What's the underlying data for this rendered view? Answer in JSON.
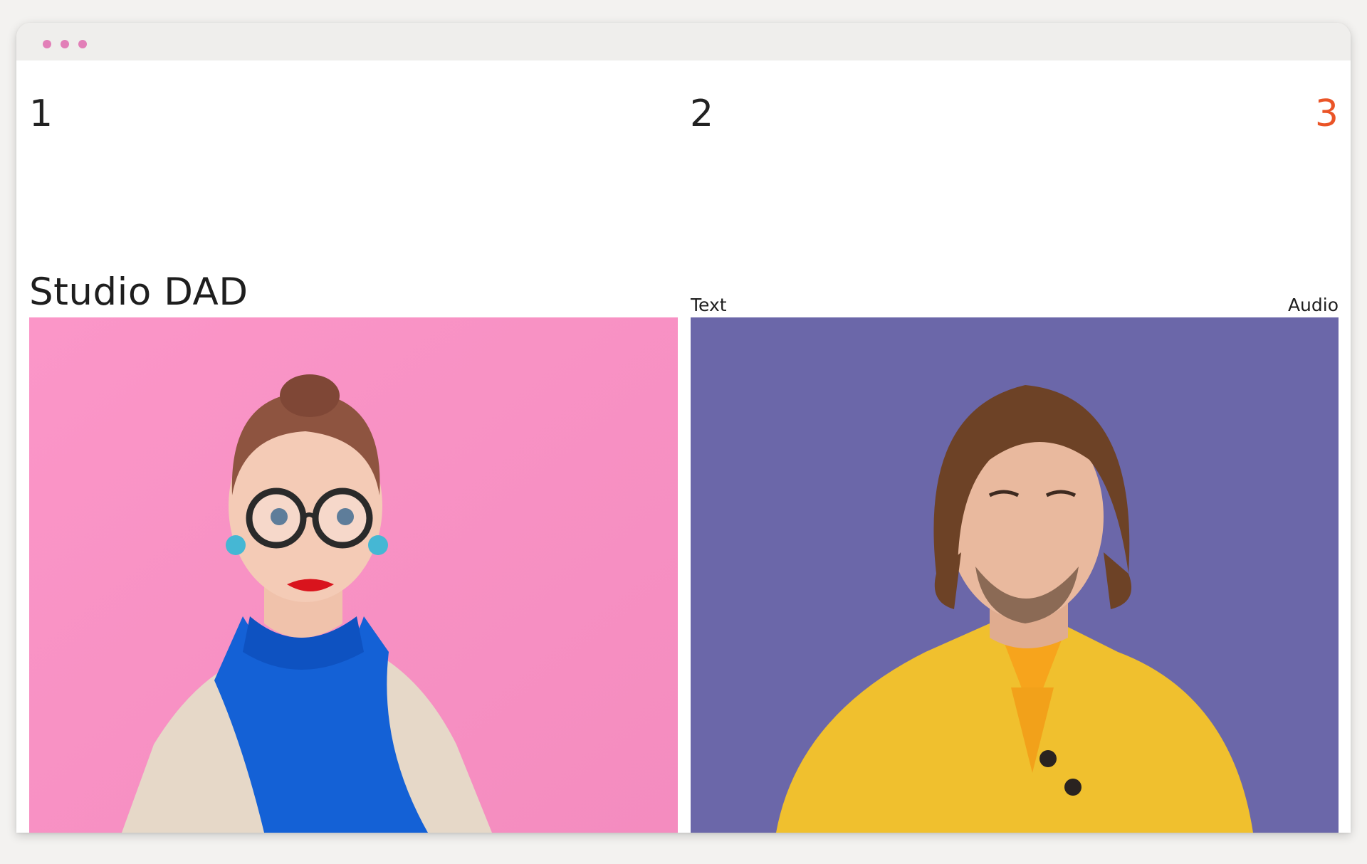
{
  "window": {
    "controls": [
      "window-dot",
      "window-dot",
      "window-dot"
    ],
    "dot_color": "#e27fb8"
  },
  "columns": {
    "first_number": "1",
    "second_number": "2",
    "third_number": "3",
    "active_color": "#ea5427"
  },
  "site": {
    "title": "Studio DAD"
  },
  "nav": {
    "text_label": "Text",
    "audio_label": "Audio"
  },
  "photos": [
    {
      "subject": "woman-portrait",
      "background": "#f993c6"
    },
    {
      "subject": "man-portrait",
      "background": "#6b67a9"
    }
  ]
}
